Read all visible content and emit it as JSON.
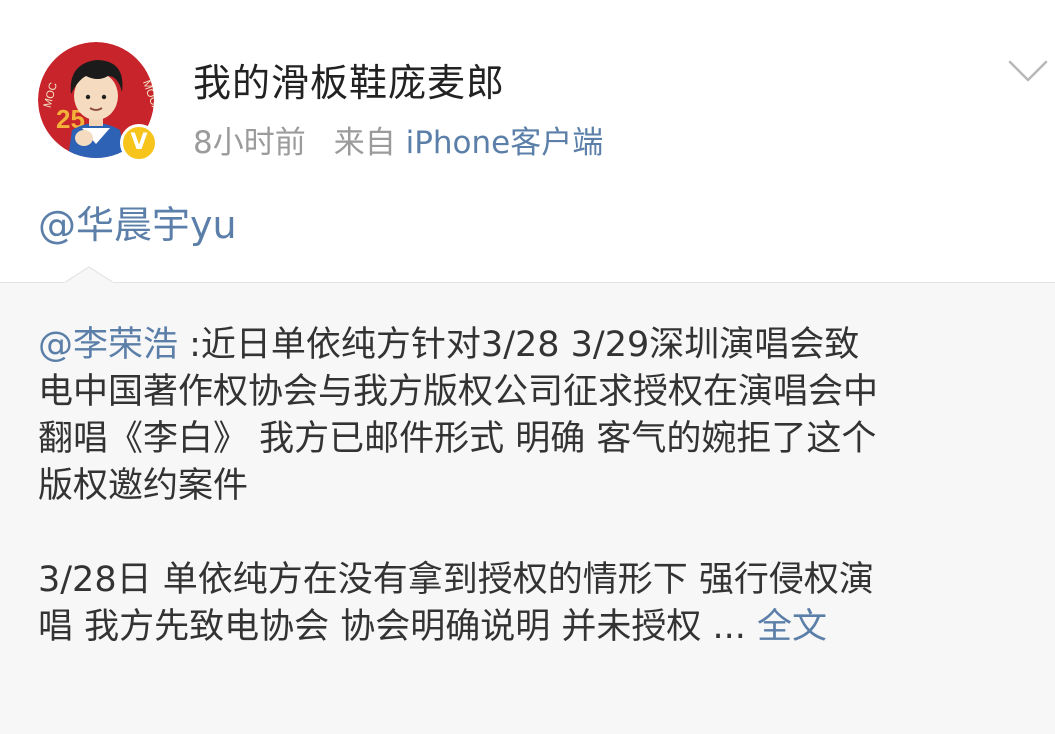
{
  "post": {
    "username": "我的滑板鞋庞麦郎",
    "time": "8小时前",
    "source_prefix": "来自",
    "source_app": "iPhone客户端",
    "text": "@华晨宇yu",
    "verified_icon": "verified-badge-icon",
    "menu_icon": "chevron-down-icon",
    "avatar_text_left": "MOC",
    "avatar_text_right": "MOCA",
    "avatar_number": "25"
  },
  "repost": {
    "mention": "@李荣浩",
    "paragraph1": [
      " :近日单依纯方针对3/28 3/29深圳演唱会致",
      "电中国著作权协会与我方版权公司征求授权在演唱会中",
      "翻唱《李白》 我方已邮件形式 明确 客气的婉拒了这个",
      "版权邀约案件"
    ],
    "paragraph2": [
      "3/28日 单依纯方在没有拿到授权的情形下 强行侵权演",
      "唱  我方先致电协会 协会明确说明 并未授权 ... "
    ],
    "full_text_link": "全文"
  },
  "colors": {
    "link": "#5b7fa8",
    "meta": "#9b9b9b",
    "text": "#333333",
    "repost_bg": "#f7f7f7",
    "verified": "#f6c41a"
  }
}
